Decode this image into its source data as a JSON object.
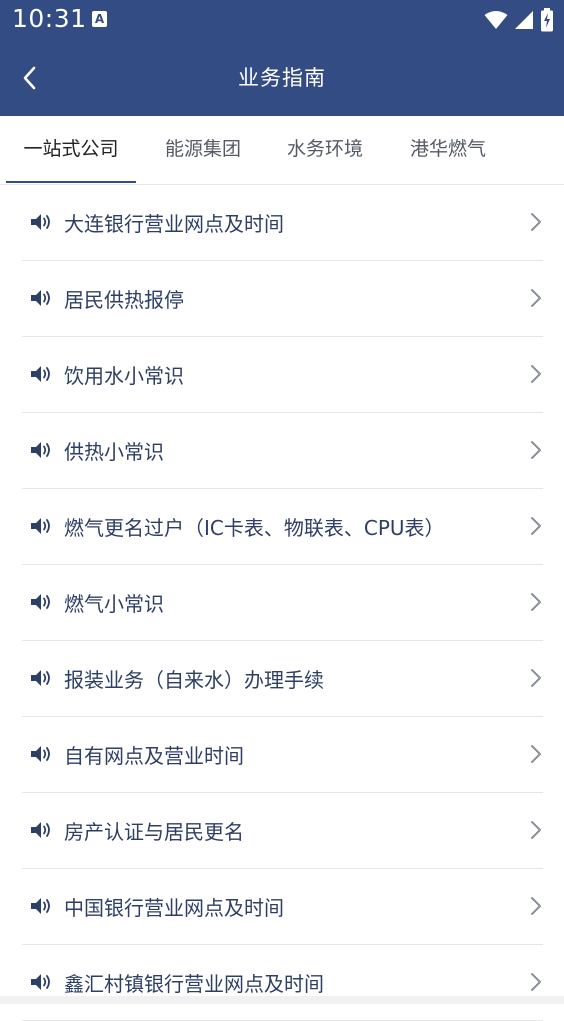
{
  "status_bar": {
    "time": "10:31",
    "app_badge": "A"
  },
  "header": {
    "title": "业务指南"
  },
  "tabs": [
    {
      "label": "一站式公司",
      "active": true
    },
    {
      "label": "能源集团",
      "active": false
    },
    {
      "label": "水务环境",
      "active": false
    },
    {
      "label": "港华燃气",
      "active": false
    }
  ],
  "items": [
    {
      "label": "大连银行营业网点及时间"
    },
    {
      "label": "居民供热报停"
    },
    {
      "label": "饮用水小常识"
    },
    {
      "label": "供热小常识"
    },
    {
      "label": "燃气更名过户（IC卡表、物联表、CPU表）"
    },
    {
      "label": "燃气小常识"
    },
    {
      "label": "报装业务（自来水）办理手续"
    },
    {
      "label": "自有网点及营业时间"
    },
    {
      "label": "房产认证与居民更名"
    },
    {
      "label": "中国银行营业网点及时间"
    },
    {
      "label": "鑫汇村镇银行营业网点及时间"
    }
  ],
  "colors": {
    "primary": "#344c84",
    "item_text": "#2e3f66"
  },
  "icons": {
    "item_icon": "speaker-icon",
    "item_arrow": "chevron-right-icon",
    "back": "back-arrow-icon"
  }
}
